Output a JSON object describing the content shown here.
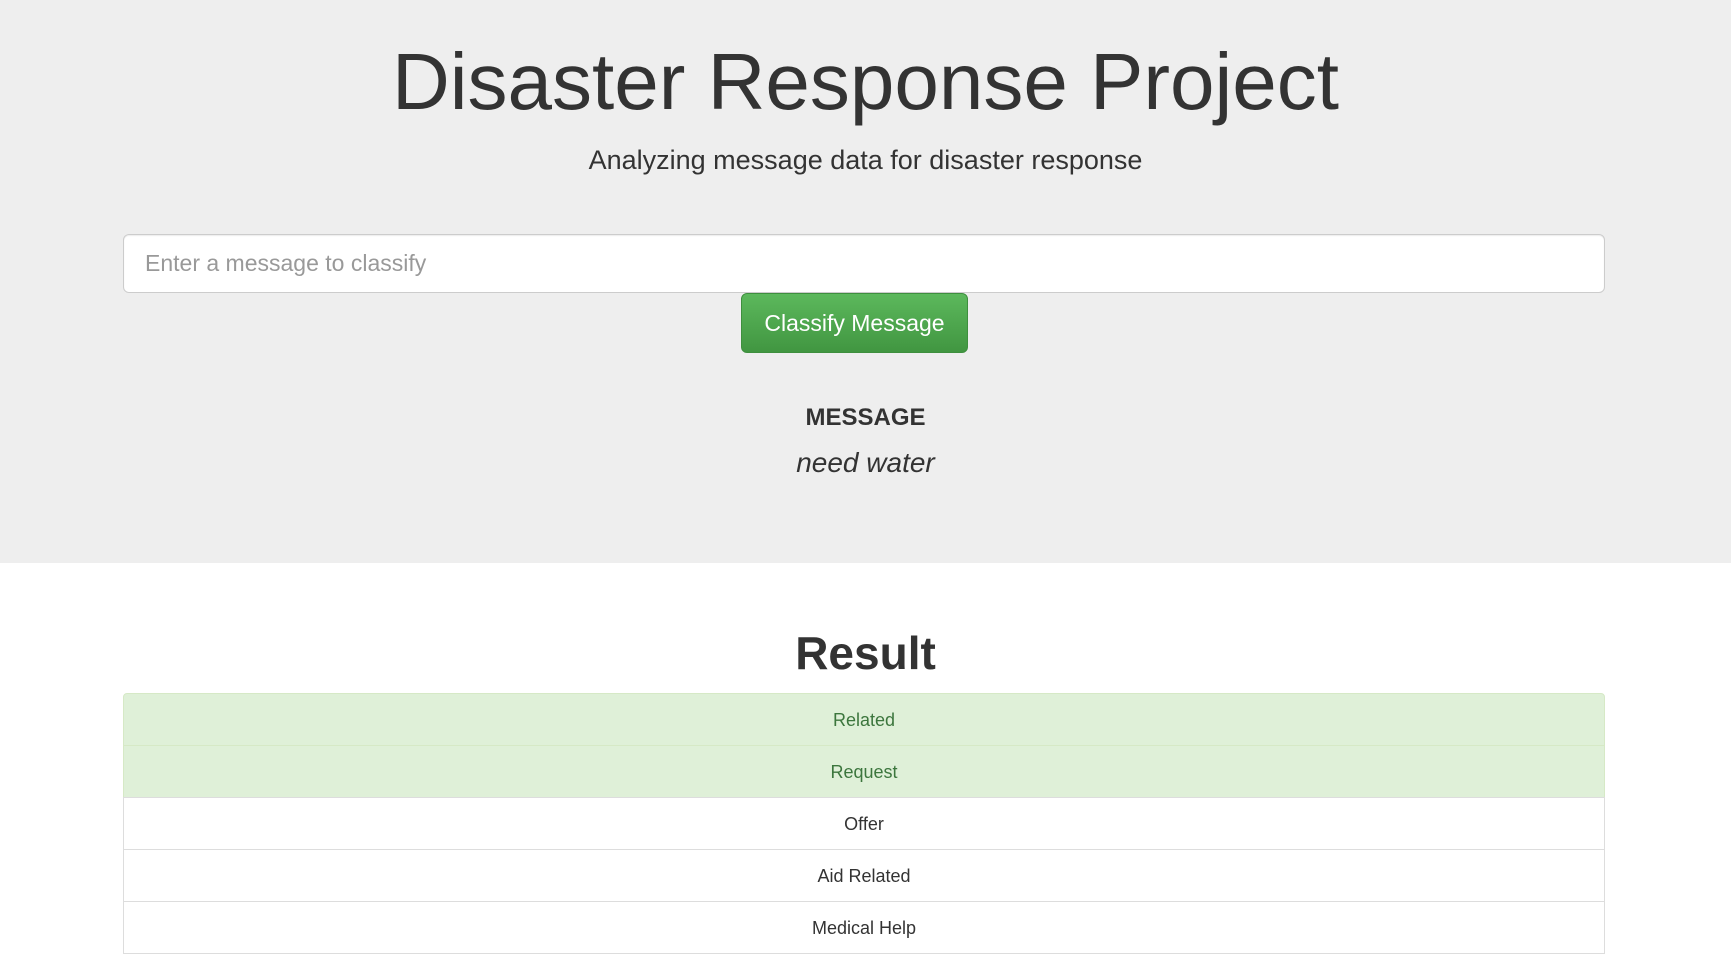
{
  "header": {
    "title": "Disaster Response Project",
    "subtitle": "Analyzing message data for disaster response"
  },
  "form": {
    "placeholder": "Enter a message to classify",
    "value": "",
    "button_label": "Classify Message"
  },
  "message": {
    "heading": "MESSAGE",
    "text": "need water"
  },
  "result": {
    "title": "Result",
    "items": [
      {
        "label": "Related",
        "positive": true
      },
      {
        "label": "Request",
        "positive": true
      },
      {
        "label": "Offer",
        "positive": false
      },
      {
        "label": "Aid Related",
        "positive": false
      },
      {
        "label": "Medical Help",
        "positive": false
      }
    ]
  },
  "colors": {
    "jumbotron_bg": "#eeeeee",
    "button_green": "#5cb85c",
    "positive_bg": "#dff0d8",
    "positive_text": "#3c763d"
  }
}
